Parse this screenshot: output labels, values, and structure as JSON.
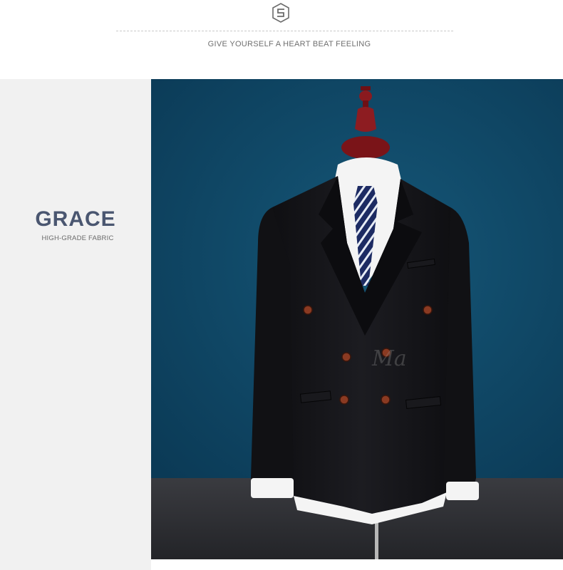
{
  "header": {
    "logo_icon": "s-box-logo-icon",
    "tagline": "GIVE YOURSELF A HEART BEAT FEELING"
  },
  "side_panel": {
    "title": "GRACE",
    "subtitle": "HIGH-GRADE FABRIC"
  },
  "photo": {
    "watermark": "Ma        ",
    "colors": {
      "background": "#0f4a6c",
      "floor": "#2e2f34",
      "jacket": "#141417",
      "buttons": "#8a3a22",
      "mannequin": "#7a1418",
      "tie": "#1d2b63"
    }
  }
}
